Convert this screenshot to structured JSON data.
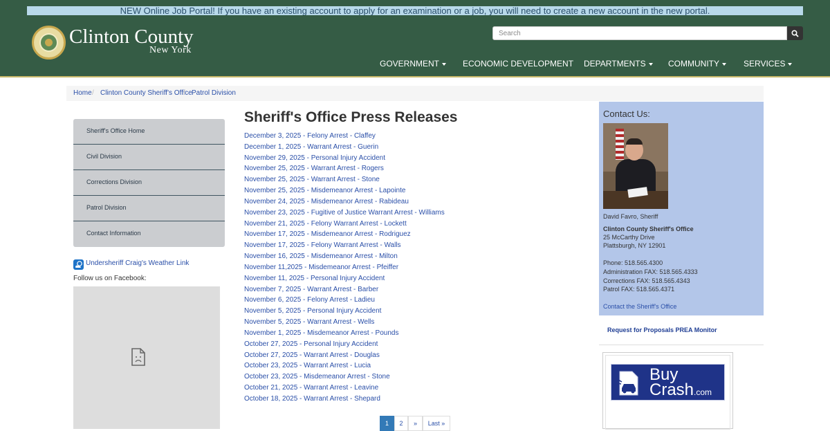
{
  "alert": {
    "text": "NEW Online Job Portal! If you have an existing account to apply for an examination or a job, you will need to create a new account in the new portal."
  },
  "brand": {
    "name": "Clinton County",
    "state": "New York"
  },
  "search": {
    "placeholder": "Search"
  },
  "nav": {
    "items": [
      {
        "label": "GOVERNMENT",
        "dropdown": true
      },
      {
        "label": "ECONOMIC DEVELOPMENT",
        "dropdown": false
      },
      {
        "label": "DEPARTMENTS",
        "dropdown": true
      },
      {
        "label": "COMMUNITY",
        "dropdown": true
      },
      {
        "label": "SERVICES",
        "dropdown": true
      }
    ]
  },
  "breadcrumb": [
    "Home",
    "Clinton County Sheriff's Office",
    "Patrol Division"
  ],
  "sidebar": {
    "items": [
      {
        "label": "Sheriff's Office Home"
      },
      {
        "label": "Civil Division"
      },
      {
        "label": "Corrections Division"
      },
      {
        "label": "Patrol Division"
      },
      {
        "label": "Contact Information"
      }
    ],
    "weather_link": "Undersheriff Craig's Weather Link",
    "follow_text": "Follow us on Facebook:"
  },
  "main": {
    "title": "Sheriff's Office Press Releases",
    "releases": [
      "December 3, 2025 - Felony Arrest - Claffey",
      "December 1, 2025 - Warrant Arrest - Guerin",
      "November 29, 2025 - Personal Injury Accident",
      "November 25, 2025 - Warrant Arrest - Rogers",
      "November 25, 2025 - Warrant Arrest - Stone",
      "November 25, 2025 - Misdemeanor Arrest - Lapointe",
      "November 24, 2025 - Misdemeanor Arrest - Rabideau",
      "November 23, 2025 - Fugitive of Justice Warrant Arrest - Williams",
      "November 21, 2025 - Felony Warrant Arrest - Lockett",
      "November 17, 2025 - Misdemeanor Arrest - Rodriguez",
      "November 17, 2025 - Felony Warrant Arrest - Walls",
      "November 16, 2025 - Misdemeanor Arrest - Milton",
      "November 11,2025 - Misdemeanor Arrest - Pfeiffer",
      "November 11, 2025 - Personal Injury Accident",
      "November 7, 2025 - Warrant Arrest - Barber",
      "November 6, 2025 - Felony Arrest - Ladieu",
      "November 5, 2025 - Personal Injury Accident",
      "November 5, 2025 - Warrant Arrest - Wells",
      "November 1, 2025 - Misdemeanor Arrest - Pounds",
      "October 27, 2025 - Personal Injury Accident",
      "October 27, 2025 - Warrant Arrest - Douglas",
      "October 23, 2025 - Warrant Arrest - Lucia",
      "October 23, 2025 - Misdemeanor Arrest - Stone",
      "October 21, 2025 - Warrant Arrest - Leavine",
      "October 18, 2025 - Warrant Arrest - Shepard"
    ],
    "pagination": {
      "pages": [
        "1",
        "2"
      ],
      "active": "1",
      "next": "»",
      "last": "Last »"
    }
  },
  "contact": {
    "title": "Contact Us:",
    "name": "David Favro, Sheriff",
    "office": "Clinton County Sheriff's Office",
    "address1": "25 McCarthy Drive",
    "address2": "Plattsburgh, NY 12901",
    "phone": "Phone: 518.565.4300",
    "admin_fax": "Administration FAX: 518.565.4333",
    "corrections_fax": "Corrections FAX: 518.565.4343",
    "patrol_fax": "Patrol FAX: 518.565.4371",
    "link": "Contact the Sheriff's Office"
  },
  "right": {
    "rfp_link": "Request for Proposals PREA Monitor",
    "buycrash": {
      "buy": "Buy",
      "crash": "Crash",
      "com": ".com"
    }
  },
  "colors": {
    "header_bg": "#355c45",
    "alert_bg": "#b8d9ea",
    "link": "#2a4fa8",
    "contact_bg": "#b3c6e9",
    "sidebar_bg": "#cbcdd0",
    "buycrash_bg": "#1f3388"
  },
  "icons": [
    "county-seal-icon",
    "search-icon",
    "weather-app-icon",
    "broken-image-icon",
    "buycrash-car-icon"
  ]
}
